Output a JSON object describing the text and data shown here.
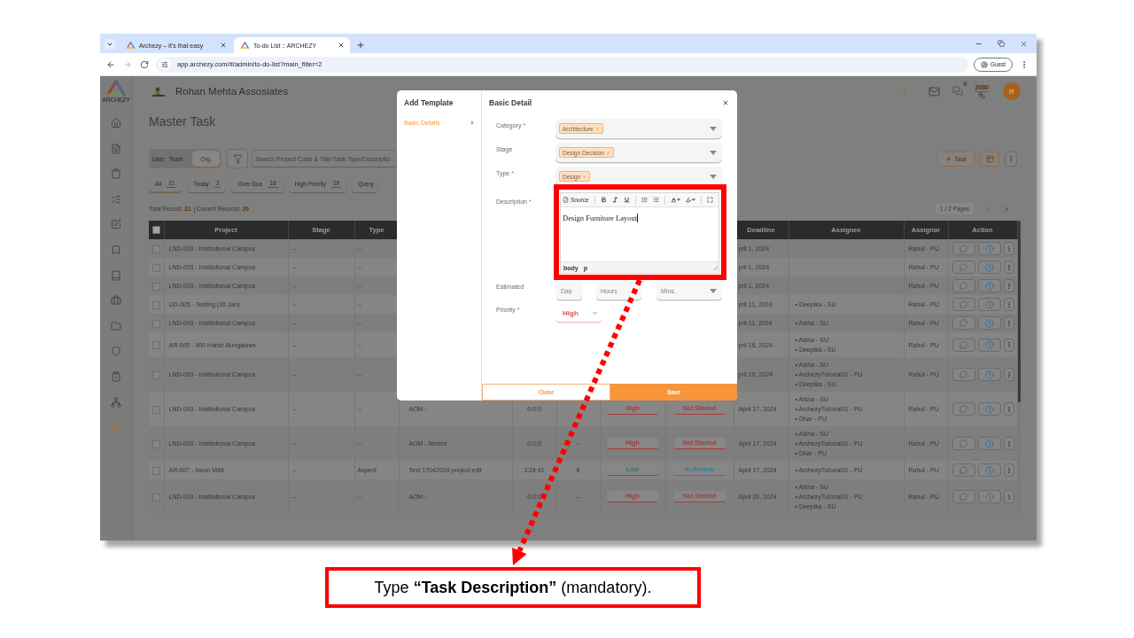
{
  "browser": {
    "tabs": [
      {
        "title": "Archezy – It's that easy",
        "selected": false
      },
      {
        "title": "To-do List :: ARCHEZY",
        "selected": true
      }
    ],
    "url": "app.archezy.com/#/admin/to-do-list?main_filter=2",
    "profile": "Guest"
  },
  "app": {
    "logo_text": "ARCHEZY",
    "sidebar": [
      {
        "kind": "home",
        "highlighted": false
      },
      {
        "kind": "document",
        "highlighted": false
      },
      {
        "kind": "clipboard",
        "highlighted": false
      },
      {
        "kind": "checklist",
        "highlighted": false
      },
      {
        "kind": "edit",
        "highlighted": false
      },
      {
        "kind": "bookmark",
        "highlighted": false
      },
      {
        "kind": "book",
        "highlighted": false
      },
      {
        "kind": "briefcase",
        "highlighted": false
      },
      {
        "kind": "folder",
        "highlighted": false
      },
      {
        "kind": "shield",
        "highlighted": false
      },
      {
        "kind": "clipboard-check",
        "highlighted": false
      },
      {
        "kind": "network",
        "highlighted": false
      },
      {
        "kind": "package",
        "highlighted": true
      }
    ],
    "company": "Rohan Mehta Assosiates",
    "messages_count": "0",
    "points": "2080",
    "avatar": "R",
    "page_title": "Master Task",
    "scope_toggle": [
      {
        "label": "User",
        "selected": false
      },
      {
        "label": "Team",
        "selected": false
      },
      {
        "label": "Org.",
        "selected": true
      }
    ],
    "search": {
      "placeholder": "Search Project Code & Title/Task Type/Descriptio"
    },
    "add_task_button": "Task",
    "filter_tabs": [
      {
        "label": "All",
        "count": "21",
        "selected": true
      },
      {
        "label": "Today",
        "count": "3",
        "selected": false
      },
      {
        "label": "Over Due",
        "count": "18",
        "selected": false
      },
      {
        "label": "High Priority",
        "count": "19",
        "selected": false
      },
      {
        "label": "Query",
        "selected": false
      }
    ],
    "records": {
      "total_label": "Total Record:",
      "total": "21",
      "current_label": "| Current Records:",
      "current": "20"
    },
    "pagination": "1 / 2 Pages",
    "table": {
      "header_checked": false,
      "columns": [
        "Project",
        "Stage",
        "Type",
        "Deadline",
        "Assignee",
        "Assignor",
        "Action"
      ],
      "rows": [
        {
          "checked": false,
          "project": "LND-003 - Institutional Campus",
          "stage": "--",
          "type": "--",
          "deadline": "pril 1, 2024",
          "assignor": "Rahul - PU"
        },
        {
          "checked": false,
          "project": "LND-003 - Institutional Campus",
          "stage": "--",
          "type": "--",
          "deadline": "pril 1, 2024",
          "assignor": "Rahul - PU"
        },
        {
          "checked": false,
          "project": "LND-003 - Institutional Campus",
          "stage": "--",
          "type": "--",
          "deadline": "pril 1, 2024",
          "assignor": "Rahul - PU"
        },
        {
          "checked": false,
          "project": "UD-005 - Testing (26 Jan)",
          "stage": "--",
          "type": "--",
          "deadline": "pril 11, 2024",
          "assignees": [
            "• Deepika - SU"
          ],
          "assignor": "Rahul - PU"
        },
        {
          "checked": false,
          "project": "LND-003 - Institutional Campus",
          "stage": "--",
          "type": "--",
          "deadline": "pril 11, 2024",
          "assignees": [
            "• Aisha - SU"
          ],
          "assignor": "Rahul - PU"
        },
        {
          "checked": false,
          "project": "AR-005 - 900 Harsh Bungalows",
          "stage": "--",
          "type": "--",
          "deadline": "pril 16, 2024",
          "assignees": [
            "• Aisha - SU",
            "• Deepika - SU"
          ],
          "assignor": "Rahul - PU"
        },
        {
          "checked": false,
          "project": "LND-003 - Institutional Campus",
          "stage": "--",
          "type": "--",
          "deadline": "pril 16, 2024",
          "assignees": [
            "• Aisha - SU",
            "• ArchezyTutorial01 - PU",
            "• Deepika - SU"
          ],
          "assignor": "Rahul - PU"
        },
        {
          "checked": false,
          "project": "LND-003 - Institutional Campus",
          "stage": "--",
          "type": "--",
          "column_4": "AOM -",
          "column_5": "0:0:0",
          "column_7": {
            "text": "High",
            "color": "#a83b3b"
          },
          "column_8": {
            "text": "Not Started",
            "color": "#a83b3b"
          },
          "deadline": "April 17, 2024",
          "assignees": [
            "• Aisha - SU",
            "• ArchezyTutorial01 - PU",
            "• Dhar - PU"
          ],
          "assignor": "Rahul - PU"
        },
        {
          "checked": false,
          "project": "LND-003 - Institutional Campus",
          "stage": "--",
          "type": "--",
          "column_4": "AOM - Nndnd",
          "column_5": "0:0:0",
          "column_6": "--",
          "column_7": {
            "text": "High",
            "color": "#a83b3b"
          },
          "column_8": {
            "text": "Not Started",
            "color": "#a83b3b"
          },
          "deadline": "April 17, 2024",
          "assignees": [
            "• Aisha - SU",
            "• ArchezyTutorial01 - PU",
            "• Dhar - PU"
          ],
          "assignor": "Rahul - PU"
        },
        {
          "checked": false,
          "project": "AR-007 - Iscon MAll",
          "stage": "--",
          "type": "Aspect",
          "column_4": "Test 17042024 project edit",
          "column_5": "3:24:41",
          "column_6": "8",
          "column_7": {
            "text": "Low",
            "color": "#2e7a4a"
          },
          "column_8": {
            "text": "In-Review",
            "color": "#2f7f95"
          },
          "deadline": "April 17, 2024",
          "assignees": [
            "• ArchezyTutorial01 - PU"
          ],
          "assignor": "Rahul - PU"
        },
        {
          "checked": false,
          "project": "LND-003 - Institutional Campus",
          "stage": "--",
          "type": "--",
          "column_4": "AOM -",
          "column_5": "0:0:0",
          "column_6": "--",
          "column_7": {
            "text": "High",
            "color": "#a83b3b"
          },
          "column_8": {
            "text": "Not Started",
            "color": "#a83b3b"
          },
          "deadline": "April 20, 2024",
          "assignees": [
            "• Aisha - SU",
            "• ArchezyTutorial01 - PU",
            "• Deepika - SU"
          ],
          "assignor": "Rahul - PU"
        }
      ]
    }
  },
  "modal": {
    "sidebar_title": "Add Template",
    "steps": [
      {
        "label": "Basic Details",
        "selected": true
      }
    ],
    "title": "Basic Detail",
    "required_mark": "*",
    "fields": [
      {
        "kind": "chips",
        "label": "Category",
        "required": true,
        "chips": [
          "Architecture"
        ]
      },
      {
        "kind": "chips",
        "label": "Stage",
        "required": false,
        "chips": [
          "Design Decision"
        ]
      },
      {
        "kind": "chips",
        "label": "Type",
        "required": true,
        "chips": [
          "Design"
        ]
      },
      {
        "kind": "editor",
        "label": "Description",
        "required": true,
        "source_button": "Source",
        "value": "Design Furniture Layout",
        "path": [
          "body",
          "p"
        ]
      },
      {
        "kind": "duration",
        "label": "Estimated",
        "required": false,
        "placeholders": [
          "Day",
          "Hours",
          "Mins."
        ]
      },
      {
        "kind": "select",
        "label": "Priority",
        "required": true,
        "value": "High"
      }
    ],
    "close_button": "Close",
    "save_button": "Save"
  },
  "callout": {
    "text": "Type **“Task Description”** (mandatory)."
  }
}
